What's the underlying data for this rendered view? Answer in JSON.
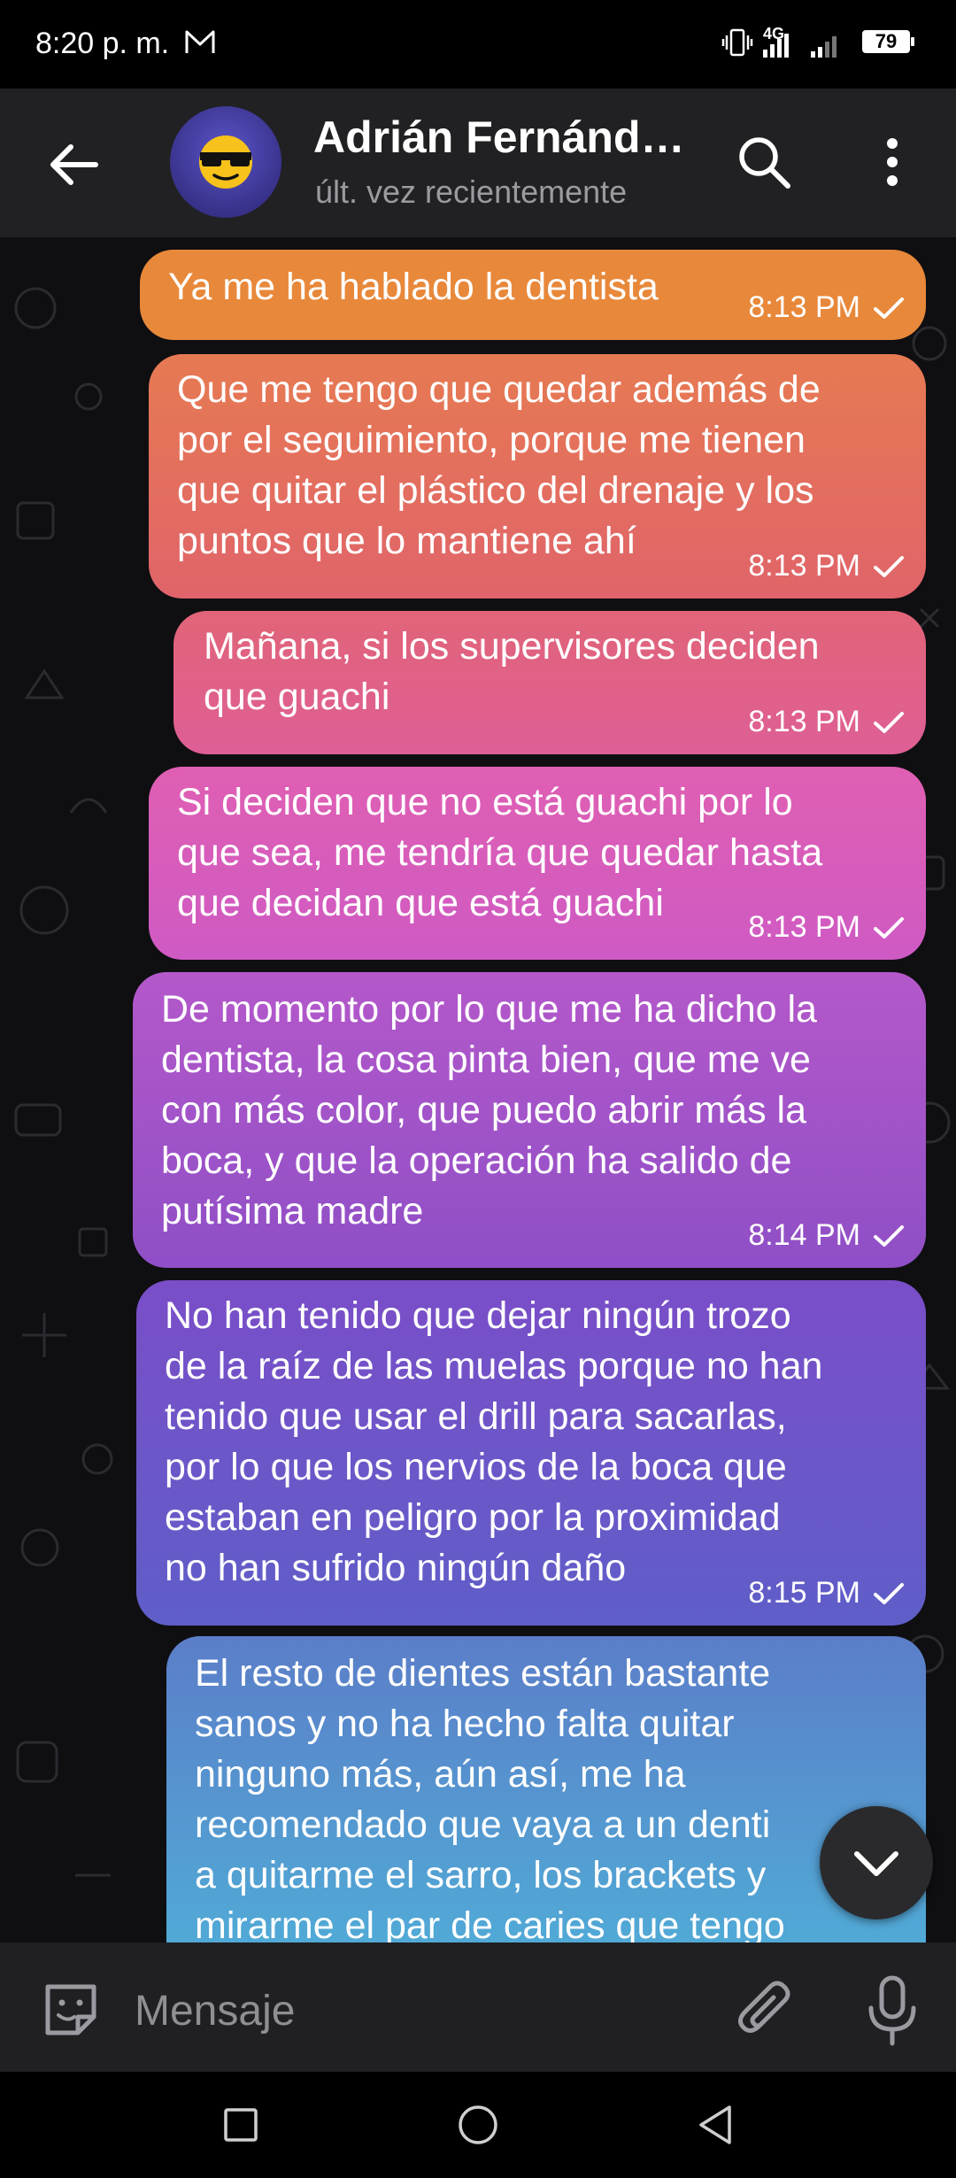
{
  "status_bar": {
    "time": "8:20 p. m.",
    "network": "4G",
    "battery": "79",
    "icons": [
      "mail-icon",
      "vibrate-icon",
      "signal-icon",
      "battery-icon"
    ]
  },
  "header": {
    "contact_name": "Adrián Fernánd…",
    "status": "últ. vez recientemente",
    "icons": [
      "back-arrow-icon",
      "avatar-sunglasses-emoji",
      "search-icon",
      "more-vert-icon"
    ]
  },
  "messages": [
    {
      "text": "Ya me ha hablado la dentista",
      "time": "8:13 PM",
      "read": true
    },
    {
      "text": "Que me tengo que quedar además de\npor el seguimiento, porque me tienen\nque quitar el plástico del drenaje y los\npuntos que lo mantiene ahí",
      "time": "8:13 PM",
      "read": true
    },
    {
      "text": "Mañana, si los supervisores deciden\nque guachi",
      "time": "8:13 PM",
      "read": true
    },
    {
      "text": "Si deciden que no está guachi por lo\nque sea, me tendría que quedar hasta\nque decidan que está guachi",
      "time": "8:13 PM",
      "read": true
    },
    {
      "text": "De momento por lo que me ha dicho la\ndentista, la cosa pinta bien, que me ve\ncon más color, que puedo abrir más la\nboca, y que la operación ha salido de\nputísima madre",
      "time": "8:14 PM",
      "read": true
    },
    {
      "text": "No han tenido que dejar ningún trozo\nde la raíz de las muelas porque no han\ntenido que usar el drill para sacarlas,\npor lo que los nervios de la boca que\nestaban en peligro por la proximidad\nno han sufrido ningún daño",
      "time": "8:15 PM",
      "read": true
    },
    {
      "text": "El resto de dientes están bastante\nsanos y no ha hecho falta quitar\nninguno más, aún así, me ha\nrecomendado que vaya a un denti\na quitarme el sarro, los brackets y\nmirarme el par de caries que tengo",
      "time": "",
      "read": false
    }
  ],
  "input": {
    "placeholder": "Mensaje",
    "icons": [
      "emoji-icon",
      "attach-icon",
      "mic-icon"
    ]
  },
  "colors": {
    "bubble_gradient": [
      "#e8883a",
      "#e0606a",
      "#dd5fa8",
      "#b655c8",
      "#8a4fc6",
      "#6a56c8",
      "#52a8d8"
    ],
    "header_bg": "#212124",
    "input_bg": "#202023"
  }
}
